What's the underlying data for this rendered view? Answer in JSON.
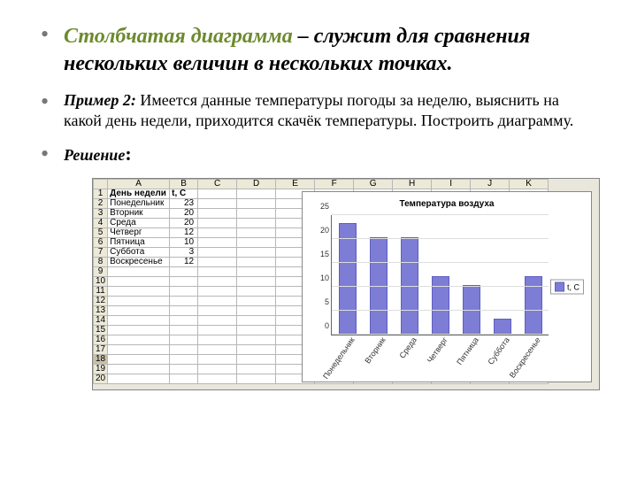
{
  "bullet1": {
    "term": "Столбчатая диаграмма",
    "desc": " – служит для сравнения нескольких величин в нескольких точках."
  },
  "bullet2": {
    "label": "Пример 2:",
    "text": "  Имеется данные температуры погоды за неделю, выяснить на какой день недели, приходится скачёк температуры. Построить диаграмму."
  },
  "bullet3": {
    "label": "Решение"
  },
  "sheet": {
    "cols": [
      "A",
      "B",
      "C",
      "D",
      "E",
      "F",
      "G",
      "H",
      "I",
      "J",
      "K"
    ],
    "header": {
      "a": "День недели",
      "b": "t, C"
    },
    "rows": [
      {
        "n": "1"
      },
      {
        "n": "2",
        "a": "Понедельник",
        "b": "23"
      },
      {
        "n": "3",
        "a": "Вторник",
        "b": "20"
      },
      {
        "n": "4",
        "a": "Среда",
        "b": "20"
      },
      {
        "n": "5",
        "a": "Четверг",
        "b": "12"
      },
      {
        "n": "6",
        "a": "Пятница",
        "b": "10"
      },
      {
        "n": "7",
        "a": "Суббота",
        "b": "3"
      },
      {
        "n": "8",
        "a": "Воскресенье",
        "b": "12"
      },
      {
        "n": "9"
      },
      {
        "n": "10"
      },
      {
        "n": "11"
      },
      {
        "n": "12"
      },
      {
        "n": "13"
      },
      {
        "n": "14"
      },
      {
        "n": "15"
      },
      {
        "n": "16"
      },
      {
        "n": "17"
      },
      {
        "n": "18",
        "sel": true
      },
      {
        "n": "19"
      },
      {
        "n": "20"
      }
    ]
  },
  "chart_data": {
    "type": "bar",
    "title": "Температура воздуха",
    "xlabel": "",
    "ylabel": "",
    "ylim": [
      0,
      25
    ],
    "yticks": [
      0,
      5,
      10,
      15,
      20,
      25
    ],
    "categories": [
      "Понедельник",
      "Вторник",
      "Среда",
      "Четверг",
      "Пятница",
      "Суббота",
      "Воскресенье"
    ],
    "values": [
      23,
      20,
      20,
      12,
      10,
      3,
      12
    ],
    "legend": "t, C",
    "bar_color": "#7d7dd6"
  }
}
